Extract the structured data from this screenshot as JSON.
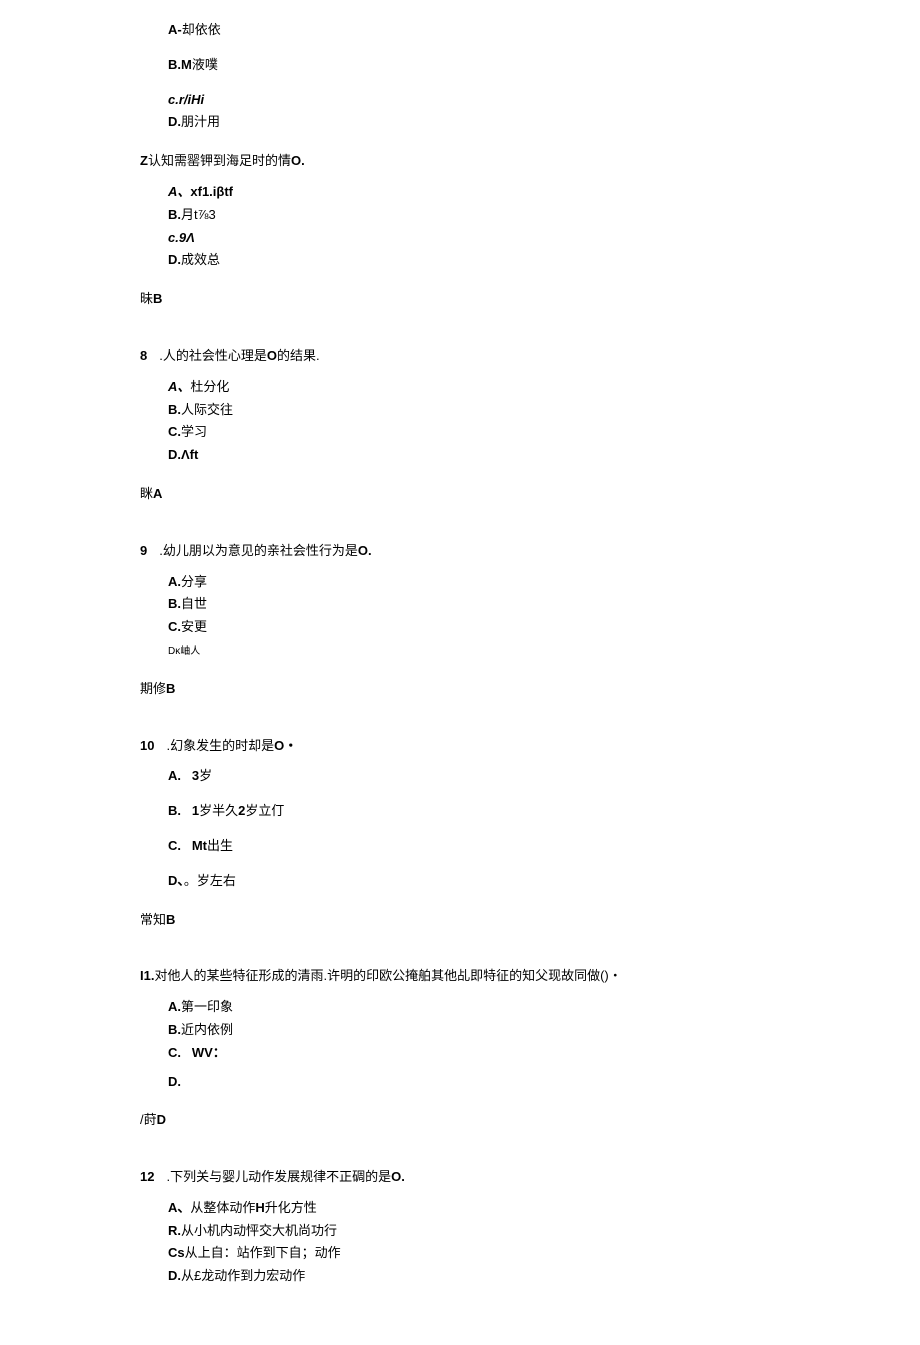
{
  "block1": {
    "opts": [
      {
        "label": "A-",
        "text": "却依依"
      },
      {
        "label": "B.M",
        "text": "液噗"
      },
      {
        "label": "c.r/iHi",
        "text": ""
      },
      {
        "label": "D.",
        "text": "朋汁用"
      }
    ]
  },
  "q7": {
    "text_prefix": "Z",
    "text": "认知需罂钾到海足时的情",
    "text_suffix": "O.",
    "opts": [
      {
        "label": "A、",
        "text": "xf1.iβtf",
        "italic": true
      },
      {
        "label": "B.",
        "text": "月t⅞3"
      },
      {
        "label": "c.9Λ",
        "text": "",
        "italic": true
      },
      {
        "label": "D.",
        "text": "成效总"
      }
    ],
    "answer_prefix": "昧",
    "answer": "B"
  },
  "q8": {
    "num": "8",
    "text": ".人的社会性心理是",
    "text_bold": "O",
    "text_after": "的结果.",
    "opts": [
      {
        "label": "A、",
        "text": "杜分化",
        "italic": true
      },
      {
        "label": "B.",
        "text": "人际交往"
      },
      {
        "label": "C.",
        "text": "学习"
      },
      {
        "label": "D.Λft",
        "text": ""
      }
    ],
    "answer_prefix": "眯",
    "answer": "A"
  },
  "q9": {
    "num": "9",
    "text": ".幼儿朋以为意见的亲社会性行为是",
    "text_bold": "O.",
    "opts": [
      {
        "label": "A.",
        "text": "分享"
      },
      {
        "label": "B.",
        "text": "自世"
      },
      {
        "label": "C.",
        "text": "安更"
      },
      {
        "label": "Dκ",
        "text": "岫人",
        "small": true
      }
    ],
    "answer_prefix": "期修",
    "answer": "B"
  },
  "q10": {
    "num": "10",
    "text": ".幻象发生的时却是",
    "text_bold": "O・",
    "opts": [
      {
        "label": "A.",
        "text": "3岁",
        "spaced": true,
        "bold_text": "3"
      },
      {
        "label": "B.",
        "text": "1岁半久2岁立仃",
        "spaced": true,
        "bold_text": "1",
        "bold_text2": "2"
      },
      {
        "label": "C.",
        "text": "Mt出生",
        "spaced": true,
        "bold_text": "Mt"
      },
      {
        "label": "D、",
        "text": "。岁左右",
        "spaced": true
      }
    ],
    "answer_prefix": "常知",
    "answer": "B"
  },
  "q11": {
    "num": "I1.",
    "text": "对他人的某些特征形成的清雨.许明的印欧公掩舶其他乩即特征的知父现故同做()・",
    "opts": [
      {
        "label": "A.",
        "text": "第一印象"
      },
      {
        "label": "B.",
        "text": "近内依例"
      },
      {
        "label": "C.",
        "text": "WV：",
        "wide": true
      },
      {
        "label": "D.",
        "text": ""
      }
    ],
    "answer_prefix": "/莳",
    "answer": "D"
  },
  "q12": {
    "num": "12",
    "text": ".下列关与婴儿动作发展规律不正碉的是",
    "text_bold": "O.",
    "opts": [
      {
        "label": "A、",
        "text": "从整体动作H升化方性",
        "bold_in": "H"
      },
      {
        "label": "R.",
        "text": "从小机内动怦交大机尚功行"
      },
      {
        "label": "Cs",
        "text": "从上自：站作到下自；动作"
      },
      {
        "label": "D.",
        "text": "从£龙动作到力宏动作"
      }
    ]
  }
}
